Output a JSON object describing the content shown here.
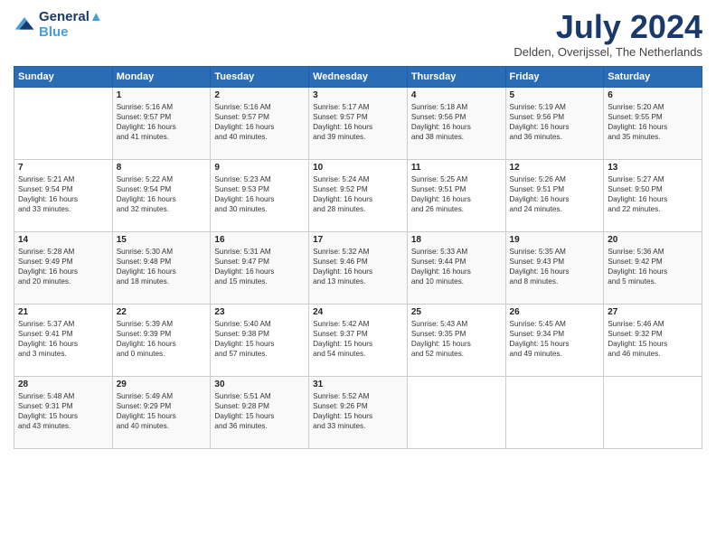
{
  "header": {
    "logo_line1": "General",
    "logo_line2": "Blue",
    "month_title": "July 2024",
    "location": "Delden, Overijssel, The Netherlands"
  },
  "days_of_week": [
    "Sunday",
    "Monday",
    "Tuesday",
    "Wednesday",
    "Thursday",
    "Friday",
    "Saturday"
  ],
  "weeks": [
    [
      {
        "day": "",
        "info": ""
      },
      {
        "day": "1",
        "info": "Sunrise: 5:16 AM\nSunset: 9:57 PM\nDaylight: 16 hours\nand 41 minutes."
      },
      {
        "day": "2",
        "info": "Sunrise: 5:16 AM\nSunset: 9:57 PM\nDaylight: 16 hours\nand 40 minutes."
      },
      {
        "day": "3",
        "info": "Sunrise: 5:17 AM\nSunset: 9:57 PM\nDaylight: 16 hours\nand 39 minutes."
      },
      {
        "day": "4",
        "info": "Sunrise: 5:18 AM\nSunset: 9:56 PM\nDaylight: 16 hours\nand 38 minutes."
      },
      {
        "day": "5",
        "info": "Sunrise: 5:19 AM\nSunset: 9:56 PM\nDaylight: 16 hours\nand 36 minutes."
      },
      {
        "day": "6",
        "info": "Sunrise: 5:20 AM\nSunset: 9:55 PM\nDaylight: 16 hours\nand 35 minutes."
      }
    ],
    [
      {
        "day": "7",
        "info": "Sunrise: 5:21 AM\nSunset: 9:54 PM\nDaylight: 16 hours\nand 33 minutes."
      },
      {
        "day": "8",
        "info": "Sunrise: 5:22 AM\nSunset: 9:54 PM\nDaylight: 16 hours\nand 32 minutes."
      },
      {
        "day": "9",
        "info": "Sunrise: 5:23 AM\nSunset: 9:53 PM\nDaylight: 16 hours\nand 30 minutes."
      },
      {
        "day": "10",
        "info": "Sunrise: 5:24 AM\nSunset: 9:52 PM\nDaylight: 16 hours\nand 28 minutes."
      },
      {
        "day": "11",
        "info": "Sunrise: 5:25 AM\nSunset: 9:51 PM\nDaylight: 16 hours\nand 26 minutes."
      },
      {
        "day": "12",
        "info": "Sunrise: 5:26 AM\nSunset: 9:51 PM\nDaylight: 16 hours\nand 24 minutes."
      },
      {
        "day": "13",
        "info": "Sunrise: 5:27 AM\nSunset: 9:50 PM\nDaylight: 16 hours\nand 22 minutes."
      }
    ],
    [
      {
        "day": "14",
        "info": "Sunrise: 5:28 AM\nSunset: 9:49 PM\nDaylight: 16 hours\nand 20 minutes."
      },
      {
        "day": "15",
        "info": "Sunrise: 5:30 AM\nSunset: 9:48 PM\nDaylight: 16 hours\nand 18 minutes."
      },
      {
        "day": "16",
        "info": "Sunrise: 5:31 AM\nSunset: 9:47 PM\nDaylight: 16 hours\nand 15 minutes."
      },
      {
        "day": "17",
        "info": "Sunrise: 5:32 AM\nSunset: 9:46 PM\nDaylight: 16 hours\nand 13 minutes."
      },
      {
        "day": "18",
        "info": "Sunrise: 5:33 AM\nSunset: 9:44 PM\nDaylight: 16 hours\nand 10 minutes."
      },
      {
        "day": "19",
        "info": "Sunrise: 5:35 AM\nSunset: 9:43 PM\nDaylight: 16 hours\nand 8 minutes."
      },
      {
        "day": "20",
        "info": "Sunrise: 5:36 AM\nSunset: 9:42 PM\nDaylight: 16 hours\nand 5 minutes."
      }
    ],
    [
      {
        "day": "21",
        "info": "Sunrise: 5:37 AM\nSunset: 9:41 PM\nDaylight: 16 hours\nand 3 minutes."
      },
      {
        "day": "22",
        "info": "Sunrise: 5:39 AM\nSunset: 9:39 PM\nDaylight: 16 hours\nand 0 minutes."
      },
      {
        "day": "23",
        "info": "Sunrise: 5:40 AM\nSunset: 9:38 PM\nDaylight: 15 hours\nand 57 minutes."
      },
      {
        "day": "24",
        "info": "Sunrise: 5:42 AM\nSunset: 9:37 PM\nDaylight: 15 hours\nand 54 minutes."
      },
      {
        "day": "25",
        "info": "Sunrise: 5:43 AM\nSunset: 9:35 PM\nDaylight: 15 hours\nand 52 minutes."
      },
      {
        "day": "26",
        "info": "Sunrise: 5:45 AM\nSunset: 9:34 PM\nDaylight: 15 hours\nand 49 minutes."
      },
      {
        "day": "27",
        "info": "Sunrise: 5:46 AM\nSunset: 9:32 PM\nDaylight: 15 hours\nand 46 minutes."
      }
    ],
    [
      {
        "day": "28",
        "info": "Sunrise: 5:48 AM\nSunset: 9:31 PM\nDaylight: 15 hours\nand 43 minutes."
      },
      {
        "day": "29",
        "info": "Sunrise: 5:49 AM\nSunset: 9:29 PM\nDaylight: 15 hours\nand 40 minutes."
      },
      {
        "day": "30",
        "info": "Sunrise: 5:51 AM\nSunset: 9:28 PM\nDaylight: 15 hours\nand 36 minutes."
      },
      {
        "day": "31",
        "info": "Sunrise: 5:52 AM\nSunset: 9:26 PM\nDaylight: 15 hours\nand 33 minutes."
      },
      {
        "day": "",
        "info": ""
      },
      {
        "day": "",
        "info": ""
      },
      {
        "day": "",
        "info": ""
      }
    ]
  ]
}
